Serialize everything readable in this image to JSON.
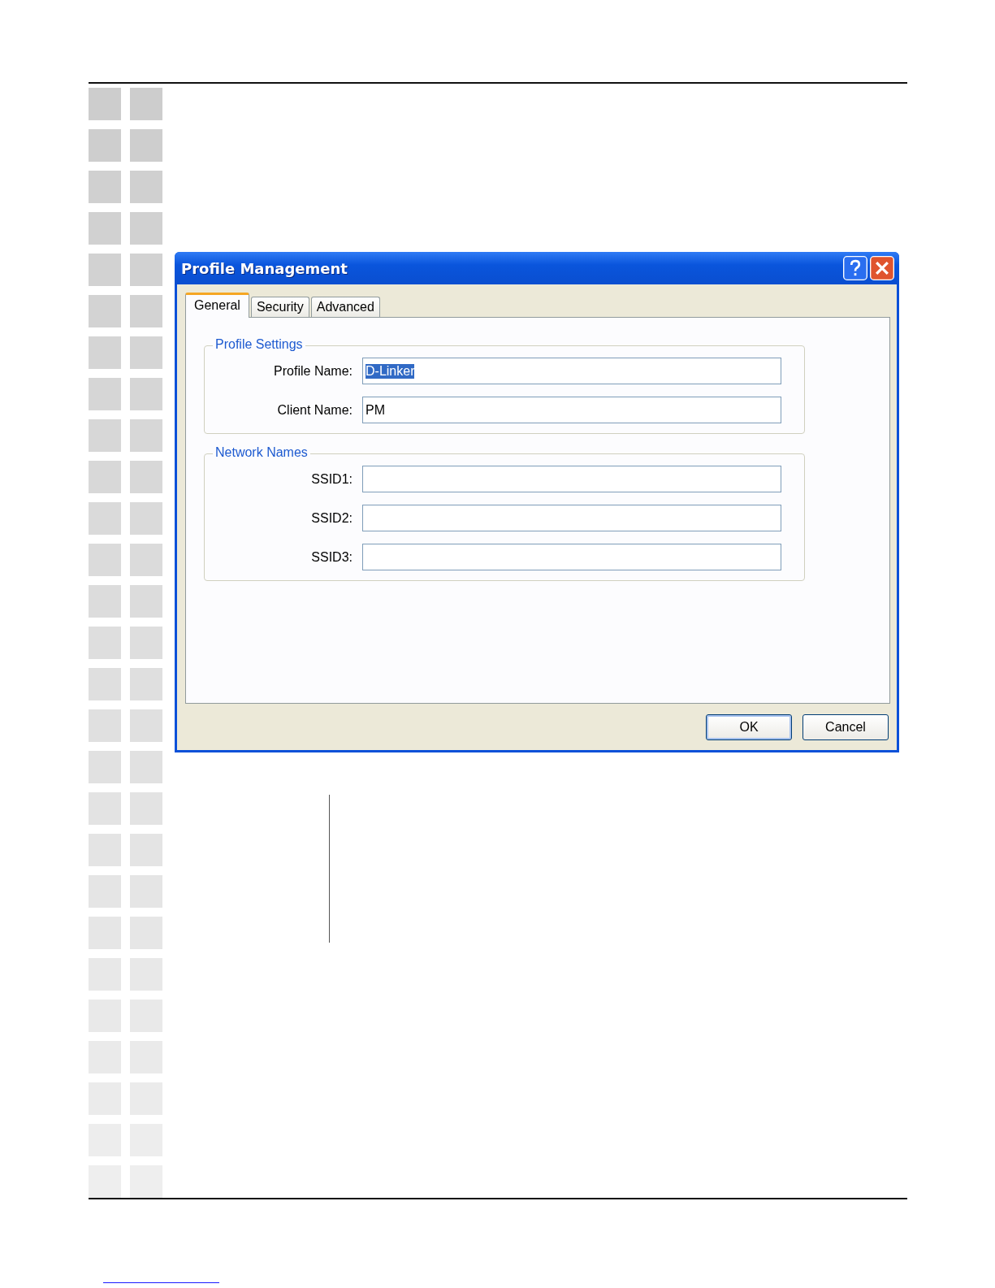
{
  "window": {
    "title": "Profile Management"
  },
  "tabs": [
    {
      "label": "General",
      "selected": true
    },
    {
      "label": "Security",
      "selected": false
    },
    {
      "label": "Advanced",
      "selected": false
    }
  ],
  "groups": [
    {
      "title": "Profile Settings",
      "fields": [
        {
          "label": "Profile Name:",
          "value": "D-Linker",
          "highlighted": true
        },
        {
          "label": "Client Name:",
          "value": "PM",
          "highlighted": false
        }
      ]
    },
    {
      "title": "Network Names",
      "fields": [
        {
          "label": "SSID1:"
        },
        {
          "label": "SSID2:"
        },
        {
          "label": "SSID3:"
        }
      ]
    }
  ],
  "buttons": [
    {
      "label": "OK",
      "default": true
    },
    {
      "label": "Cancel",
      "default": false
    }
  ]
}
